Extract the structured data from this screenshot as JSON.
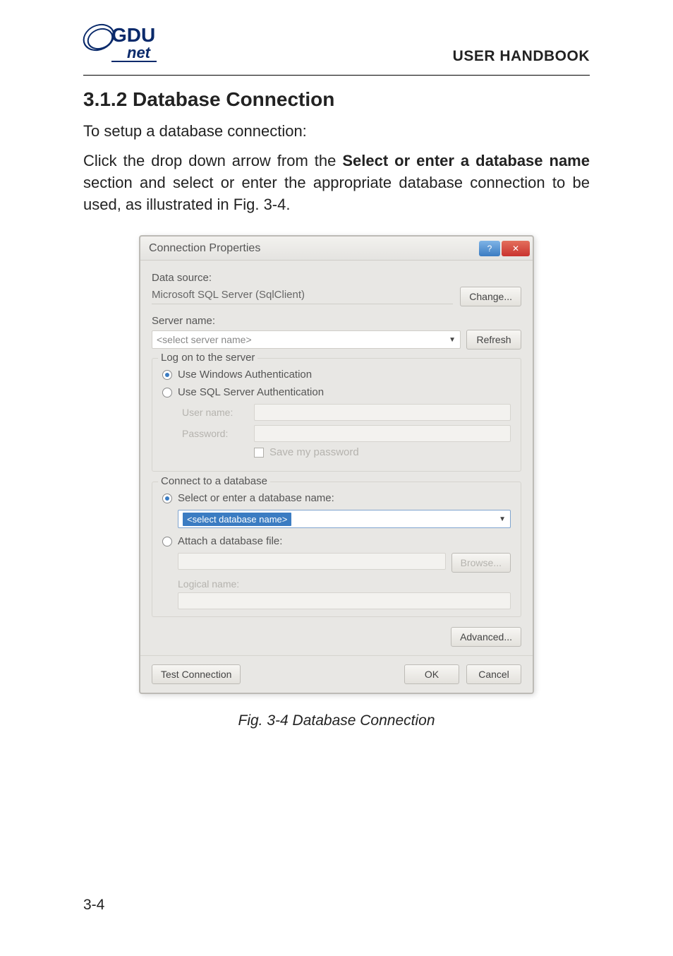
{
  "header": {
    "logo_main": "GDU",
    "logo_sub": "net",
    "handbook": "USER HANDBOOK"
  },
  "section": {
    "number_and_title": "3.1.2  Database Connection",
    "intro": "To setup a database connection:",
    "para_pre": "Click the drop down arrow from the ",
    "para_bold": "Select or enter a database name",
    "para_post": " section and select or enter the appropriate database connection to be used, as illustrated in Fig. 3-4."
  },
  "dialog": {
    "title": "Connection Properties",
    "help_glyph": "?",
    "close_glyph": "✕",
    "data_source_label": "Data source:",
    "data_source_value": "Microsoft SQL Server (SqlClient)",
    "change_btn": "Change...",
    "server_name_label": "Server name:",
    "server_name_value": "<select server name>",
    "refresh_btn": "Refresh",
    "logon_group": "Log on to the server",
    "radio_win_auth": "Use Windows Authentication",
    "radio_sql_auth": "Use SQL Server Authentication",
    "user_name_label": "User name:",
    "password_label": "Password:",
    "save_pw_label": "Save my password",
    "connect_group": "Connect to a database",
    "radio_select_db": "Select or enter a database name:",
    "db_placeholder": "<select database name>",
    "radio_attach": "Attach a database file:",
    "browse_btn": "Browse...",
    "logical_label": "Logical name:",
    "advanced_btn": "Advanced...",
    "test_btn": "Test Connection",
    "ok_btn": "OK",
    "cancel_btn": "Cancel"
  },
  "caption": "Fig. 3-4  Database Connection",
  "page_number": "3-4"
}
